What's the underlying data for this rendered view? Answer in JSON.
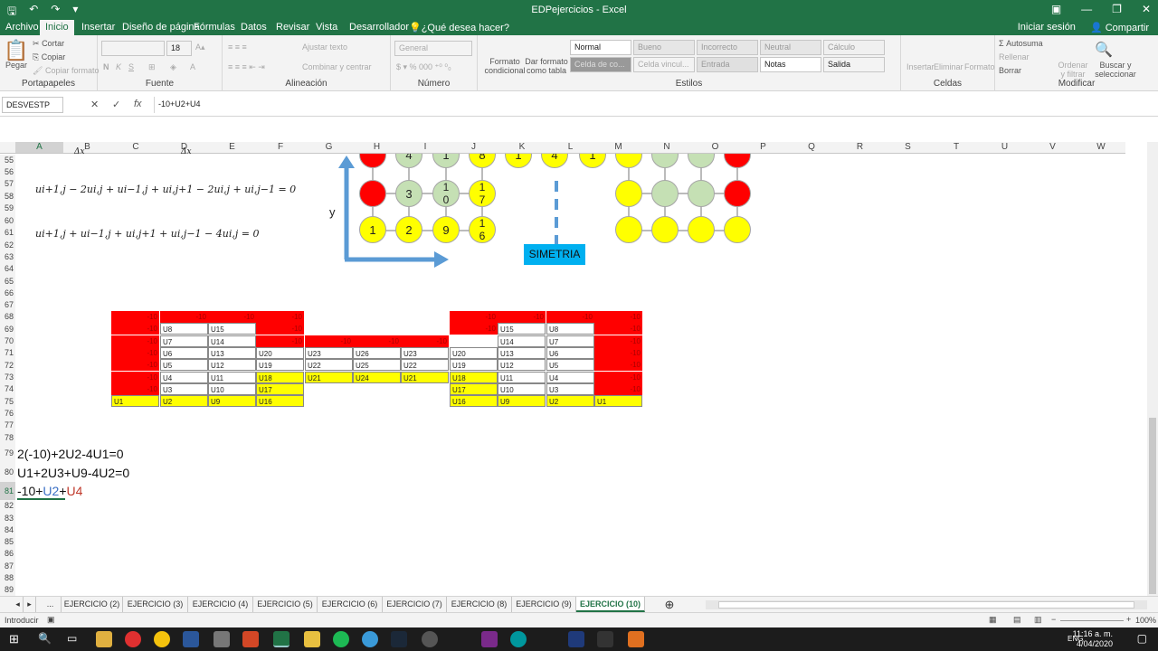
{
  "window": {
    "title": "EDPejercicios - Excel"
  },
  "ribbon_tabs": [
    "Archivo",
    "Inicio",
    "Insertar",
    "Diseño de página",
    "Fórmulas",
    "Datos",
    "Revisar",
    "Vista",
    "Desarrollador",
    "¿Qué desea hacer?"
  ],
  "ribbon_right": {
    "signin": "Iniciar sesión",
    "share": "Compartir"
  },
  "clipboard": {
    "paste": "Pegar",
    "cut": "Cortar",
    "copy": "Copiar",
    "format_painter": "Copiar formato",
    "label": "Portapapeles"
  },
  "font": {
    "size": "18",
    "label": "Fuente",
    "bold": "N",
    "italic": "K",
    "underline": "S"
  },
  "alignment": {
    "wrap": "Ajustar texto",
    "merge": "Combinar y centrar",
    "label": "Alineación"
  },
  "number": {
    "format": "General",
    "label": "Número"
  },
  "cond_format": "Formato condicional",
  "table_format": "Dar formato como tabla",
  "styles": {
    "normal": "Normal",
    "bueno": "Bueno",
    "incorrecto": "Incorrecto",
    "neutral": "Neutral",
    "calculo": "Cálculo",
    "celda": "Celda de co...",
    "vinculada": "Celda vincul...",
    "entrada": "Entrada",
    "notas": "Notas",
    "salida": "Salida",
    "label": "Estilos"
  },
  "cells": {
    "insert": "Insertar",
    "delete": "Eliminar",
    "format": "Formato",
    "label": "Celdas"
  },
  "editing": {
    "autosum": "Autosuma",
    "fill": "Rellenar",
    "clear": "Borrar",
    "sort": "Ordenar y filtrar",
    "find": "Buscar y seleccionar",
    "label": "Modificar"
  },
  "formula_bar": {
    "name_box": "DESVESTP",
    "cancel": "✕",
    "enter": "✓",
    "fx": "fx",
    "content": "-10+U2+U4"
  },
  "columns": [
    "A",
    "B",
    "C",
    "D",
    "E",
    "F",
    "G",
    "H",
    "I",
    "J",
    "K",
    "L",
    "M",
    "N",
    "O",
    "P",
    "Q",
    "R",
    "S",
    "T",
    "U",
    "V",
    "W"
  ],
  "rows": [
    "55",
    "56",
    "57",
    "58",
    "59",
    "60",
    "61",
    "62",
    "63",
    "64",
    "65",
    "66",
    "67",
    "68",
    "69",
    "70",
    "71",
    "72",
    "73",
    "74",
    "75",
    "76",
    "77",
    "78",
    "79",
    "80",
    "81",
    "82",
    "83",
    "84",
    "85",
    "86",
    "87",
    "88",
    "89",
    "90"
  ],
  "math": {
    "eq1": "ui+1,j − 2ui,j + ui−1,j + ui,j+1 − 2ui,j + ui,j−1 = 0",
    "eq2": "ui+1,j + ui−1,j + ui,j+1 + ui,j−1 − 4ui,j = 0",
    "frag_a": "Δx",
    "frag_b": "Δx",
    "y_label": "y"
  },
  "grid_circles": {
    "row1": [
      "4",
      "1",
      "8",
      "1",
      "4",
      "1"
    ],
    "row2": [
      "3",
      "1",
      "0",
      "1",
      "7"
    ],
    "row3": [
      "1",
      "2",
      "9",
      "1",
      "6"
    ]
  },
  "simetria": "SIMETRIA",
  "table_red_val": "-10",
  "table_left": {
    "row69": [
      "U8",
      "U15"
    ],
    "row70": [
      "U7",
      "U14"
    ],
    "row71": [
      "U6",
      "U13",
      "U20",
      "U23",
      "U26",
      "U23"
    ],
    "row72": [
      "U5",
      "U12",
      "U19",
      "U22",
      "U25",
      "U22"
    ],
    "row73": [
      "U4",
      "U11",
      "U18",
      "U21",
      "U24",
      "U21"
    ],
    "row74": [
      "U3",
      "U10",
      "U17"
    ],
    "row75": [
      "U1",
      "U2",
      "U9",
      "U16"
    ]
  },
  "table_right": {
    "row69": [
      "U15",
      "U8"
    ],
    "row70": [
      "U14",
      "U7"
    ],
    "row71": [
      "U20",
      "U13",
      "U6"
    ],
    "row72": [
      "U19",
      "U12",
      "U5"
    ],
    "row73": [
      "U18",
      "U11",
      "U4"
    ],
    "row74": [
      "U17",
      "U10",
      "U3"
    ],
    "row75": [
      "U16",
      "U9",
      "U2",
      "U1"
    ]
  },
  "equations": {
    "eq79": "2(-10)+2U2-4U1=0",
    "eq80": "U1+2U3+U9-4U2=0",
    "eq81_a": "-10+",
    "eq81_b": "U2",
    "eq81_c": "+",
    "eq81_d": "U4"
  },
  "sheet_tabs": [
    "...",
    "EJERCICIO (2)",
    "EJERCICIO (3)",
    "EJERCICIO (4)",
    "EJERCICIO (5)",
    "EJERCICIO (6)",
    "EJERCICIO (7)",
    "EJERCICIO (8)",
    "EJERCICIO (9)",
    "EJERCICIO (10)"
  ],
  "status": {
    "mode": "Introducir",
    "zoom": "100%"
  },
  "taskbar": {
    "time": "11:16 a. m.",
    "date": "4/04/2020",
    "lang": "ENG"
  },
  "colors": {
    "excel_green": "#217346",
    "red": "#ff0000",
    "yellow": "#ffff00",
    "light_green": "#c5e0b4",
    "blue_arrow": "#5b9bd5",
    "sim_box": "#00b0f0"
  }
}
